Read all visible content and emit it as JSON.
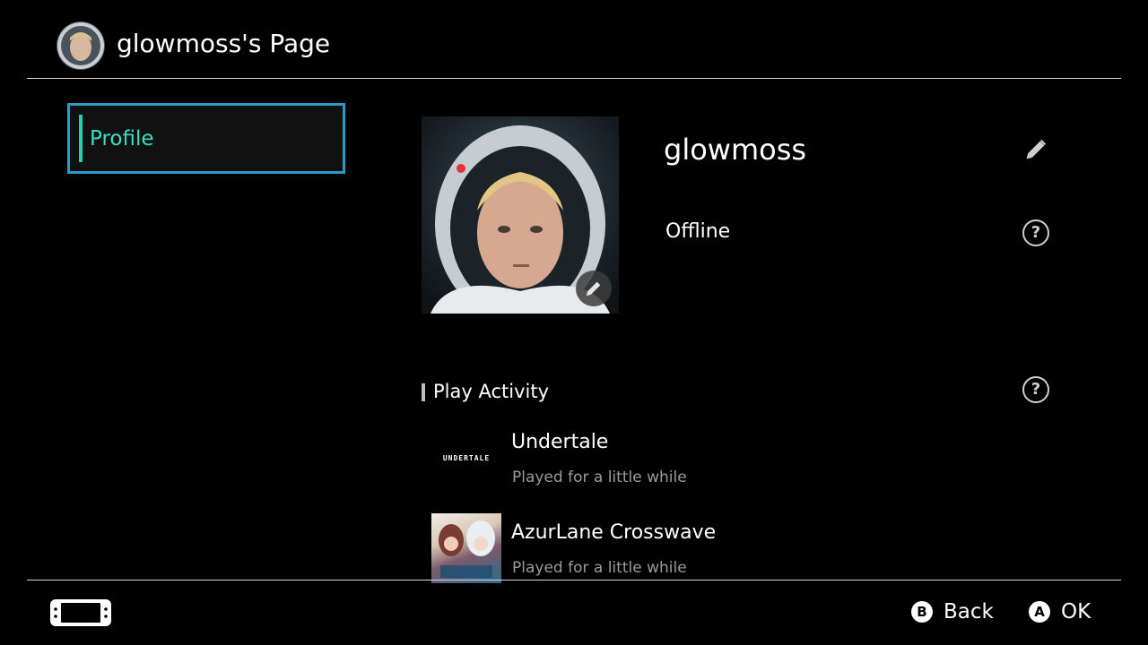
{
  "header": {
    "title": "glowmoss's Page",
    "avatar_icon": "user-avatar"
  },
  "sidebar": {
    "items": [
      {
        "label": "Profile",
        "selected": true
      }
    ]
  },
  "profile": {
    "username": "glowmoss",
    "status": "Offline",
    "edit_icon": "pencil-icon",
    "help_icon": "question-circle-icon"
  },
  "play_activity": {
    "title": "Play Activity",
    "games": [
      {
        "title": "Undertale",
        "subtitle": "Played for a little while",
        "thumb_text": "UNDERTALE"
      },
      {
        "title": "AzurLane Crosswave",
        "subtitle": "Played for a little while"
      }
    ]
  },
  "footer": {
    "back": {
      "glyph": "B",
      "label": "Back"
    },
    "ok": {
      "glyph": "A",
      "label": "OK"
    }
  },
  "colors": {
    "selection_border": "#2a9bc9",
    "selection_text": "#33e0bf",
    "subtext": "#9a9a9a"
  }
}
